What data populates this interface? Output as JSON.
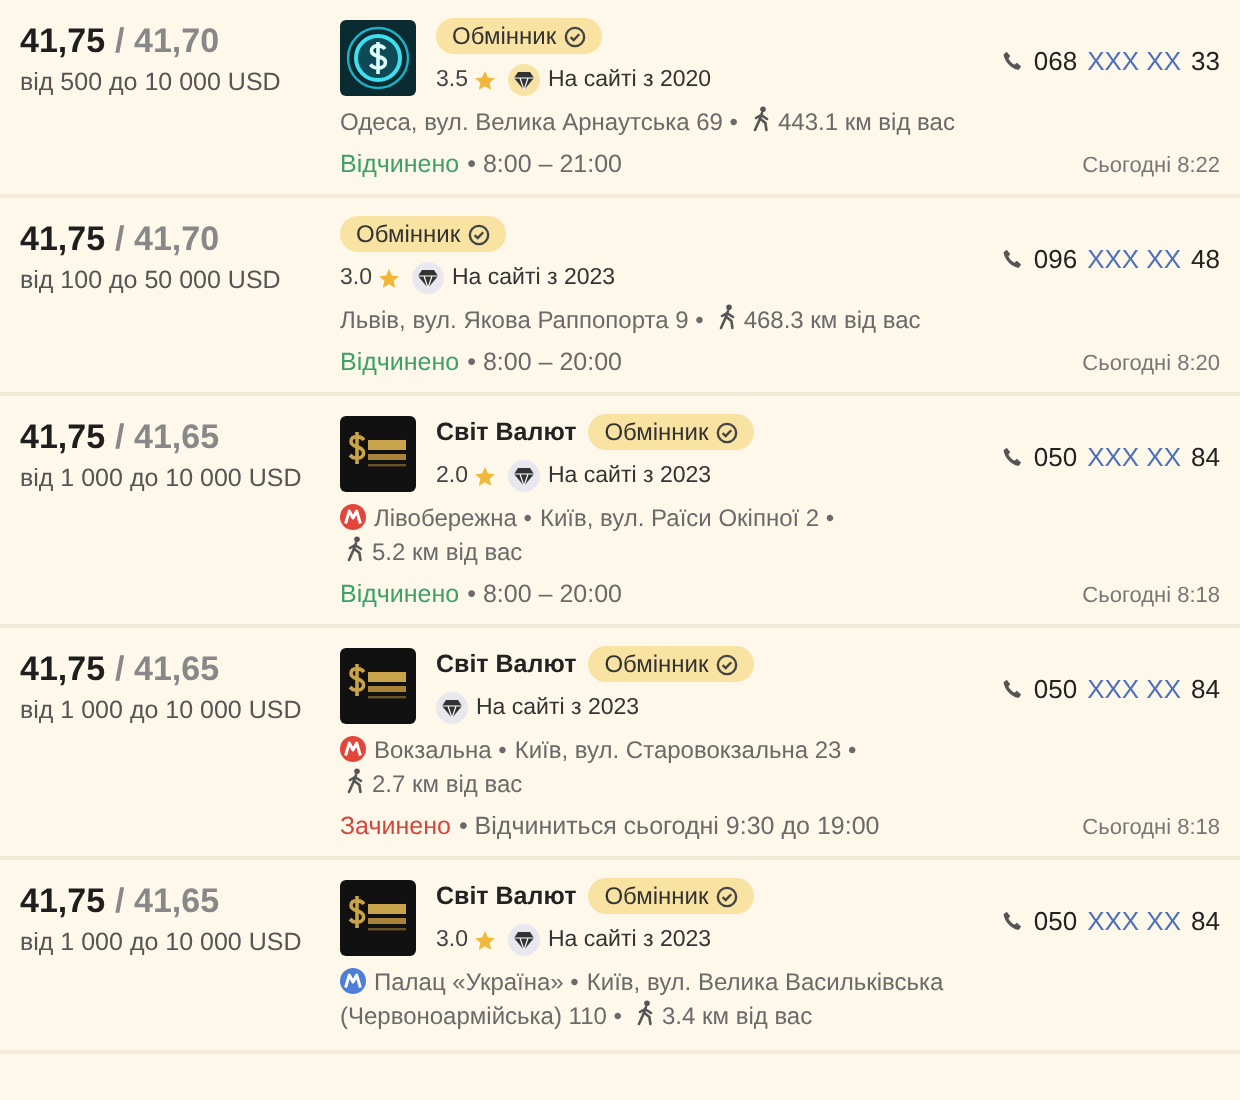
{
  "offers": [
    {
      "buy": "41,75",
      "sell": "/ 41,70",
      "range": "від 500 до 10 000 USD",
      "logo": {
        "kind": "dollar"
      },
      "badge": "Обмінник",
      "rating": "3.5",
      "since": {
        "text": "На сайті з 2020",
        "color": "#f8e3a3"
      },
      "address": [
        "Одеса, вул. Велика Арнаутська 69 •"
      ],
      "distance": "443.1 км від вас",
      "open": true,
      "status": "Відчинено",
      "hours": "• 8:00 – 21:00",
      "phone": {
        "prefix": "068",
        "hidden": "XXX XX",
        "suffix": "33"
      },
      "updated": "Сьогодні 8:22"
    },
    {
      "buy": "41,75",
      "sell": "/ 41,70",
      "range": "від 100 до 50 000 USD",
      "badge": "Обмінник",
      "rating": "3.0",
      "since": {
        "text": "На сайті з 2023",
        "color": "#e9e8ef"
      },
      "address": [
        "Львів, вул. Якова Раппопорта 9 •"
      ],
      "distance": "468.3 км від вас",
      "open": true,
      "status": "Відчинено",
      "hours": "• 8:00 – 20:00",
      "phone": {
        "prefix": "096",
        "hidden": "XXX XX",
        "suffix": "48"
      },
      "updated": "Сьогодні 8:20"
    },
    {
      "buy": "41,75",
      "sell": "/ 41,65",
      "range": "від 1 000 до 10 000 USD",
      "logo": {
        "kind": "bars"
      },
      "name": "Світ Валют",
      "badge": "Обмінник",
      "rating": "2.0",
      "since": {
        "text": "На сайті з 2023",
        "color": "#e9e8ef"
      },
      "station": {
        "text": "Лівобережна •",
        "color": "#e2453a"
      },
      "address": [
        "Київ, вул. Раїси Окіпної 2 •"
      ],
      "distance": "5.2 км від вас",
      "open": true,
      "status": "Відчинено",
      "hours": "• 8:00 – 20:00",
      "phone": {
        "prefix": "050",
        "hidden": "XXX XX",
        "suffix": "84"
      },
      "updated": "Сьогодні 8:18"
    },
    {
      "buy": "41,75",
      "sell": "/ 41,65",
      "range": "від 1 000 до 10 000 USD",
      "logo": {
        "kind": "bars"
      },
      "name": "Світ Валют",
      "badge": "Обмінник",
      "since": {
        "text": "На сайті з 2023",
        "color": "#e9e8ef"
      },
      "station": {
        "text": "Вокзальна •",
        "color": "#e2453a"
      },
      "address": [
        "Київ, вул. Старовокзальна 23 •"
      ],
      "distance": "2.7 км від вас",
      "open": false,
      "status": "Зачинено",
      "hours": "• Відчиниться сьогодні 9:30 до 19:00",
      "phone": {
        "prefix": "050",
        "hidden": "XXX XX",
        "suffix": "84"
      },
      "updated": "Сьогодні 8:18"
    },
    {
      "buy": "41,75",
      "sell": "/ 41,65",
      "range": "від 1 000 до 10 000 USD",
      "logo": {
        "kind": "bars"
      },
      "name": "Світ Валют",
      "badge": "Обмінник",
      "rating": "3.0",
      "since": {
        "text": "На сайті з 2023",
        "color": "#e9e8ef"
      },
      "station": {
        "text": "Палац «Україна» •",
        "color": "#4d7fd8"
      },
      "address": [
        "Київ, вул. Велика Васильківська",
        "(Червоноармійська) 110 •"
      ],
      "distance": "3.4 км від вас",
      "phone": {
        "prefix": "050",
        "hidden": "XXX XX",
        "suffix": "84"
      }
    }
  ]
}
